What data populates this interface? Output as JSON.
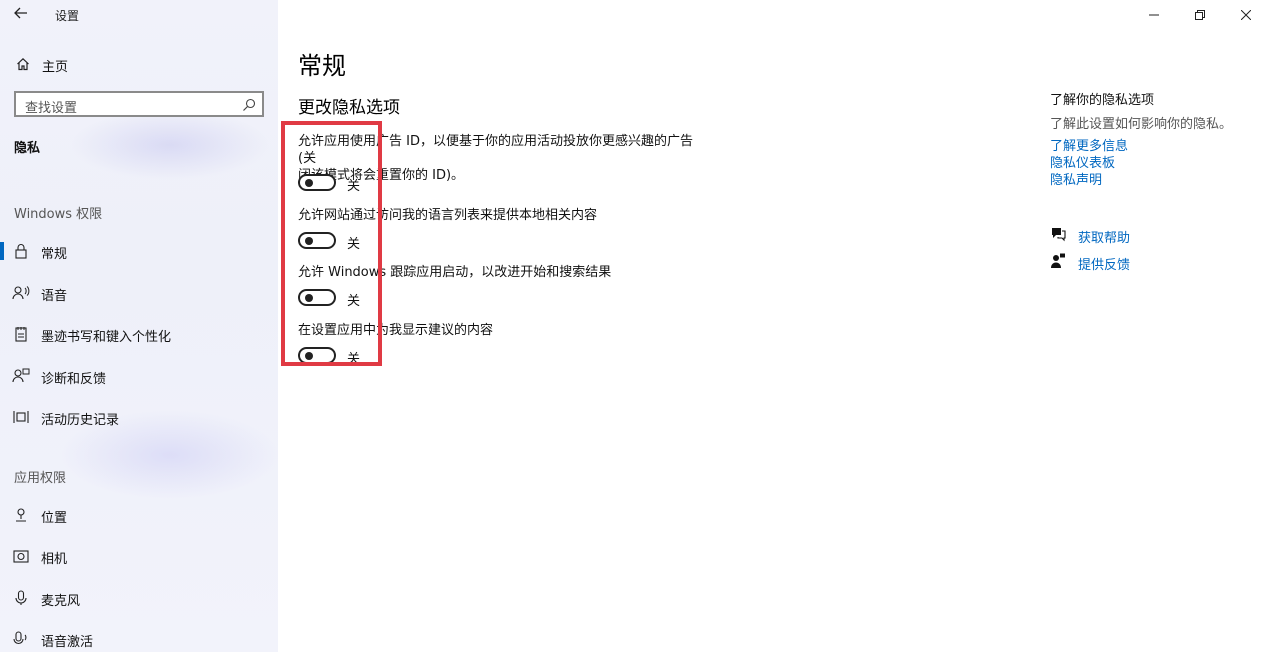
{
  "window": {
    "title": "设置"
  },
  "sidebar": {
    "home_label": "主页",
    "search_placeholder": "查找设置",
    "current_section": "隐私",
    "group_windows": "Windows 权限",
    "group_apps": "应用权限",
    "items_windows": [
      {
        "label": "常规",
        "icon": "lock-icon",
        "selected": true
      },
      {
        "label": "语音",
        "icon": "speech-icon",
        "selected": false
      },
      {
        "label": "墨迹书写和键入个性化",
        "icon": "notepad-icon",
        "selected": false
      },
      {
        "label": "诊断和反馈",
        "icon": "feedback-person-icon",
        "selected": false
      },
      {
        "label": "活动历史记录",
        "icon": "timeline-icon",
        "selected": false
      }
    ],
    "items_apps": [
      {
        "label": "位置",
        "icon": "location-icon"
      },
      {
        "label": "相机",
        "icon": "camera-icon"
      },
      {
        "label": "麦克风",
        "icon": "microphone-icon"
      },
      {
        "label": "语音激活",
        "icon": "voice-activation-icon"
      }
    ]
  },
  "main": {
    "page_title": "常规",
    "section_title": "更改隐私选项",
    "settings": [
      {
        "desc_line1": "允许应用使用广告 ID，以便基于你的应用活动投放你更感兴趣的广告(关",
        "desc_line2": "闭该模式将会重置你的 ID)。",
        "state": "关",
        "on": false
      },
      {
        "desc_line1": "允许网站通过访问我的语言列表来提供本地相关内容",
        "desc_line2": "",
        "state": "关",
        "on": false
      },
      {
        "desc_line1": "允许 Windows 跟踪应用启动，以改进开始和搜索结果",
        "desc_line2": "",
        "state": "关",
        "on": false
      },
      {
        "desc_line1": "在设置应用中为我显示建议的内容",
        "desc_line2": "",
        "state": "关",
        "on": false
      }
    ]
  },
  "aside": {
    "title": "了解你的隐私选项",
    "desc": "了解此设置如何影响你的隐私。",
    "links": [
      "了解更多信息",
      "隐私仪表板",
      "隐私声明"
    ],
    "help_label": "获取帮助",
    "feedback_label": "提供反馈"
  },
  "colors": {
    "accent": "#0067c0",
    "highlight": "#e03a44"
  }
}
